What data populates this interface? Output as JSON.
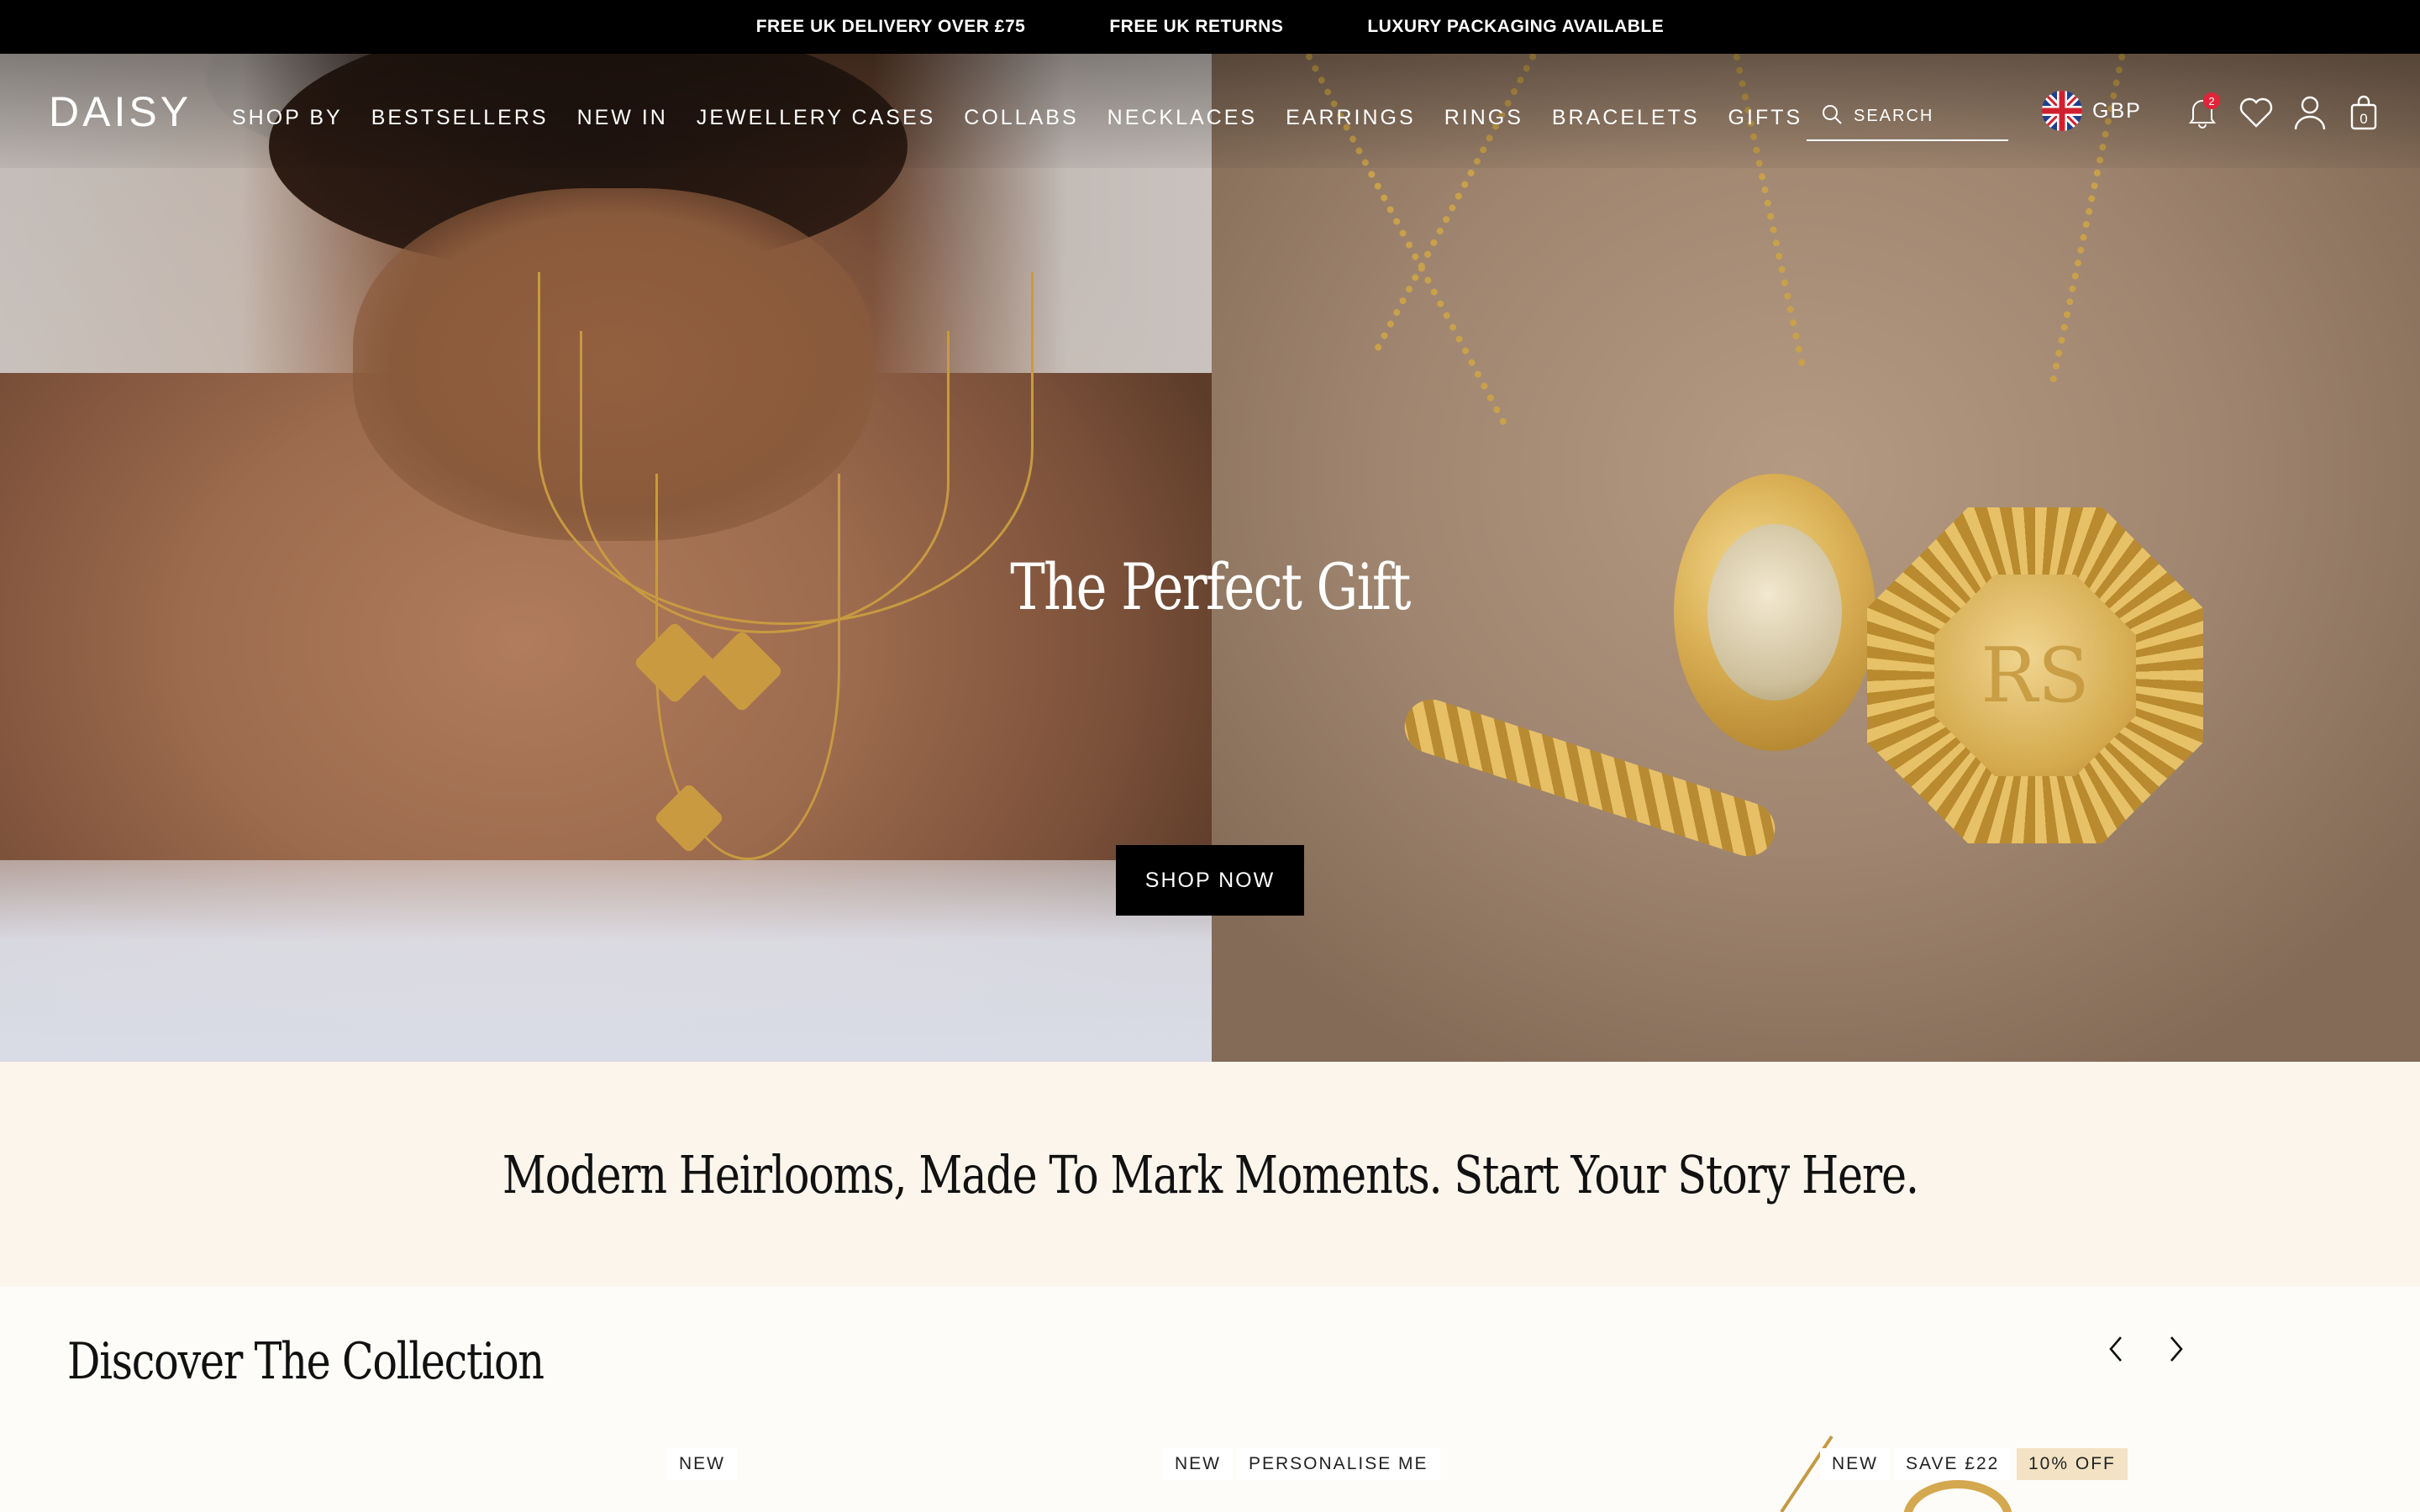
{
  "announcement": {
    "items": [
      "FREE UK DELIVERY OVER £75",
      "FREE UK RETURNS",
      "LUXURY PACKAGING AVAILABLE"
    ]
  },
  "header": {
    "logo": "DAISY",
    "nav": [
      "SHOP BY",
      "BESTSELLERS",
      "NEW IN",
      "JEWELLERY CASES",
      "COLLABS",
      "NECKLACES",
      "EARRINGS",
      "RINGS",
      "BRACELETS",
      "GIFTS"
    ],
    "search_placeholder": "SEARCH",
    "currency": "GBP",
    "notification_count": "2",
    "bag_count": "0",
    "icons": [
      "search-icon",
      "uk-flag-icon",
      "bell-icon",
      "heart-icon",
      "account-icon",
      "bag-icon"
    ]
  },
  "hero": {
    "title": "The Perfect Gift",
    "cta": "SHOP NOW",
    "pendant_engraving": "RS"
  },
  "tagline": "Modern Heirlooms, Made To Mark Moments. Start Your Story Here.",
  "collection": {
    "title": "Discover The Collection",
    "tags": {
      "product1": [
        "NEW"
      ],
      "product2": [
        "NEW",
        "PERSONALISE ME"
      ],
      "product3": [
        "NEW",
        "SAVE £22",
        "10% OFF"
      ]
    }
  },
  "colors": {
    "announcement_bg": "#000000",
    "tagline_bg": "#fcf5ec",
    "cta_bg": "#000000",
    "badge": "#e0253a",
    "sale_tag": "#f3e3c4"
  }
}
